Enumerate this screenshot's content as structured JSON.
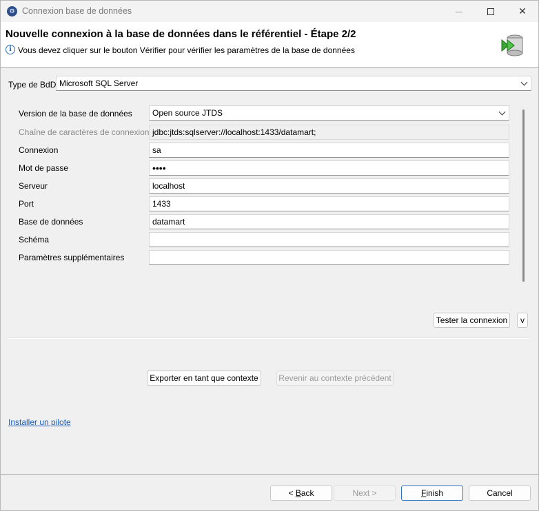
{
  "window": {
    "title": "Connexion base de données"
  },
  "header": {
    "title": "Nouvelle connexion à la base de données dans le référentiel - Étape 2/2",
    "message": "Vous devez cliquer sur le bouton Vérifier pour vérifier les paramètres de la base de données"
  },
  "db_type": {
    "label": "Type de BdD",
    "value": "Microsoft SQL Server"
  },
  "form": {
    "version": {
      "label": "Version de la base de données",
      "value": "Open source JTDS"
    },
    "connection_string": {
      "label": "Chaîne de caractères de connexion",
      "value": "jdbc:jtds:sqlserver://localhost:1433/datamart;"
    },
    "login": {
      "label": "Connexion",
      "value": "sa"
    },
    "password": {
      "label": "Mot de passe",
      "value": "••••"
    },
    "server": {
      "label": "Serveur",
      "value": "localhost"
    },
    "port": {
      "label": "Port",
      "value": "1433"
    },
    "database": {
      "label": "Base de données",
      "value": "datamart"
    },
    "schema": {
      "label": "Schéma",
      "value": ""
    },
    "additional_params": {
      "label": "Paramètres supplémentaires",
      "value": ""
    }
  },
  "buttons": {
    "test_connection": "Tester la connexion",
    "test_dropdown": "v",
    "export_context": "Exporter en tant que contexte",
    "revert_context": "Revenir au contexte précédent",
    "back_mnemonic": "B",
    "back_rest": "ack",
    "back_prefix": "< ",
    "next": "Next >",
    "finish_mnemonic": "F",
    "finish_rest": "inish",
    "cancel": "Cancel"
  },
  "install_driver_link": "Installer un pilote",
  "icons": {
    "app": "database-connection-icon",
    "info": "info-icon",
    "header": "database-wizard-icon"
  },
  "colors": {
    "link": "#1a5db8",
    "accent_border": "#2b6fbf",
    "icon_green": "#3aa835"
  }
}
